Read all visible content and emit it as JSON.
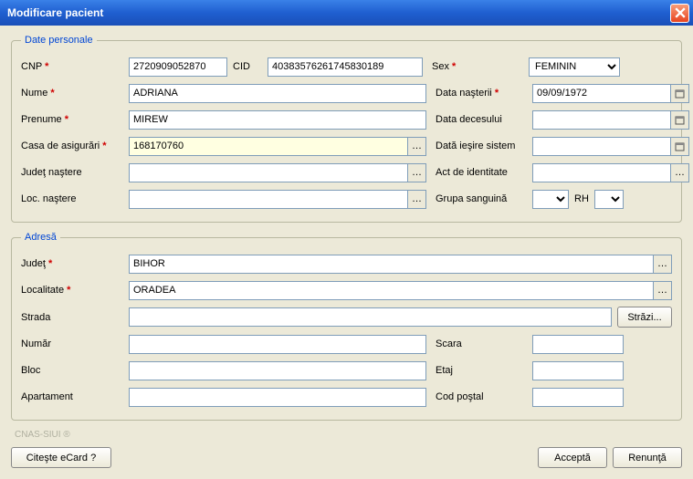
{
  "title": "Modificare pacient",
  "legends": {
    "personal": "Date personale",
    "address": "Adresă"
  },
  "labels": {
    "cnp": "CNP",
    "cid": "CID",
    "sex": "Sex",
    "nume": "Nume",
    "dob": "Data naşterii",
    "prenume": "Prenume",
    "dod": "Data decesului",
    "casa": "Casa de asigurări",
    "out": "Dată ieşire sistem",
    "judet_nastere": "Judeţ naştere",
    "act": "Act de identitate",
    "loc_nastere": "Loc. naştere",
    "grupa": "Grupa sanguină",
    "rh": "RH",
    "judet": "Judeţ",
    "localitate": "Localitate",
    "strada": "Strada",
    "strazi_btn": "Străzi...",
    "numar": "Număr",
    "scara": "Scara",
    "bloc": "Bloc",
    "etaj": "Etaj",
    "apartament": "Apartament",
    "cod_postal": "Cod poştal"
  },
  "values": {
    "cnp": "2720909052870",
    "cid": "40383576261745830189",
    "sex": "FEMININ",
    "nume": "ADRIANA",
    "dob": "09/09/1972",
    "prenume": "MIREW",
    "casa": "168170760",
    "judet": "BIHOR",
    "localitate": "ORADEA"
  },
  "buttons": {
    "ecard": "Citeşte eCard ?",
    "accept": "Acceptă",
    "cancel": "Renunţă"
  },
  "copyright": "CNAS-SIUI ®"
}
